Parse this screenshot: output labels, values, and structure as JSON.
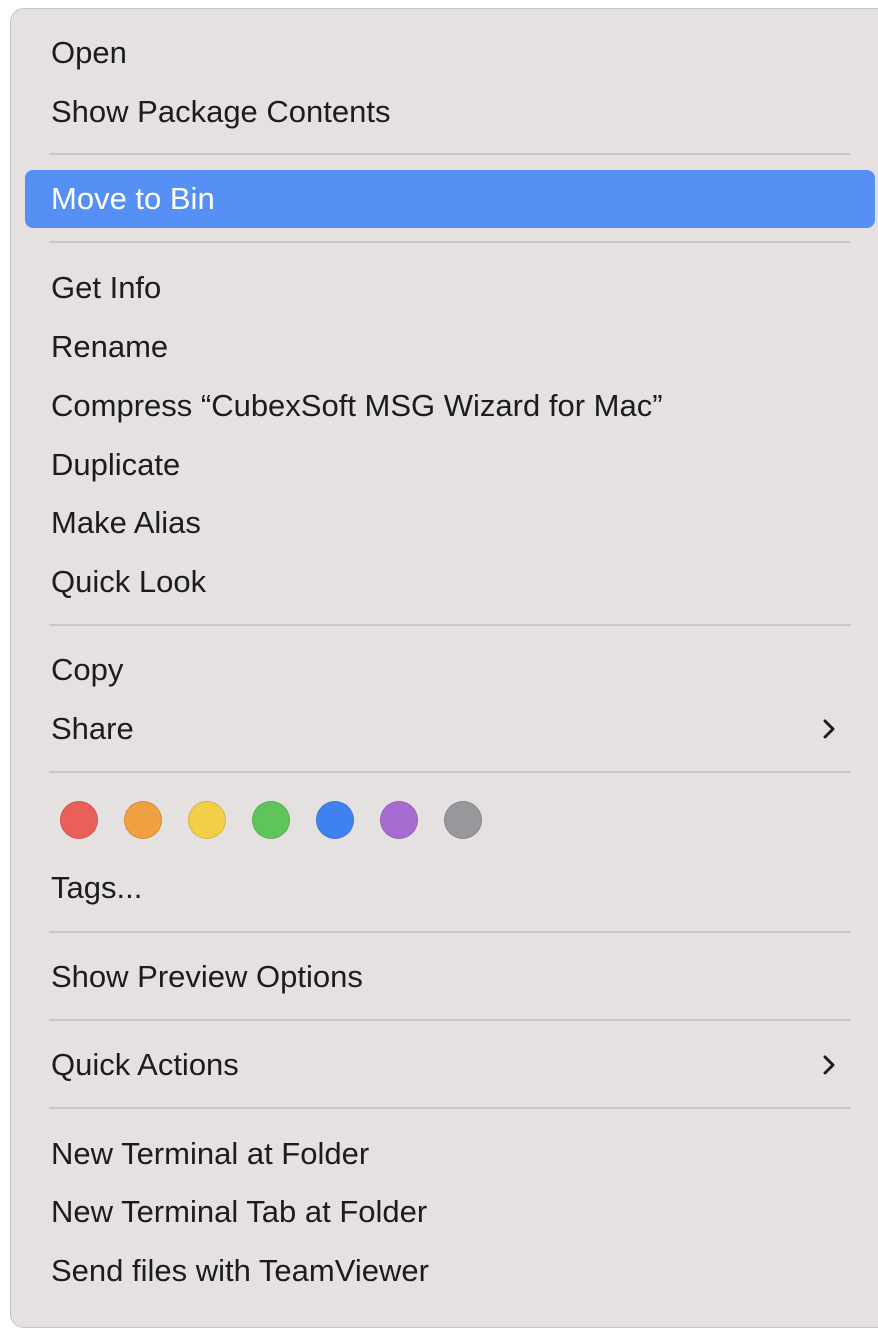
{
  "menu": {
    "items": [
      {
        "label": "Open"
      },
      {
        "label": "Show Package Contents"
      },
      {
        "label": "Move to Bin"
      },
      {
        "label": "Get Info"
      },
      {
        "label": "Rename"
      },
      {
        "label": "Compress “CubexSoft MSG Wizard for Mac”"
      },
      {
        "label": "Duplicate"
      },
      {
        "label": "Make Alias"
      },
      {
        "label": "Quick Look"
      },
      {
        "label": "Copy"
      },
      {
        "label": "Share"
      },
      {
        "label": "Tags..."
      },
      {
        "label": "Show Preview Options"
      },
      {
        "label": "Quick Actions"
      },
      {
        "label": "New Terminal at Folder"
      },
      {
        "label": "New Terminal Tab at Folder"
      },
      {
        "label": "Send files with TeamViewer"
      }
    ],
    "highlighted_item": "Move to Bin",
    "tag_colors": [
      {
        "name": "red",
        "color": "#ea5f57"
      },
      {
        "name": "orange",
        "color": "#efa041"
      },
      {
        "name": "yellow",
        "color": "#f3cf47"
      },
      {
        "name": "green",
        "color": "#60c45c"
      },
      {
        "name": "blue",
        "color": "#3f82ef"
      },
      {
        "name": "purple",
        "color": "#a76bd1"
      },
      {
        "name": "gray",
        "color": "#98979b"
      }
    ],
    "accent_color": "#5690f4",
    "submenu_icon": "chevron-right-icon"
  }
}
